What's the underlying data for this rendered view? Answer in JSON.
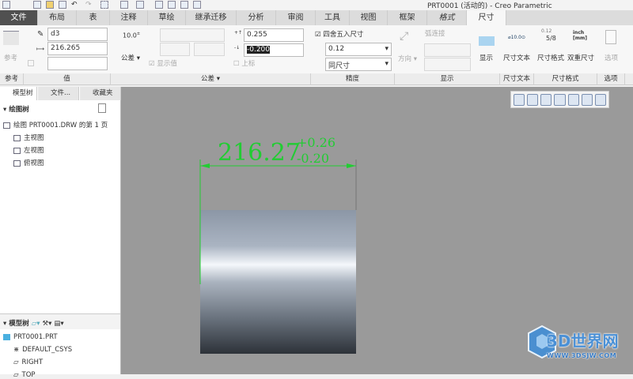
{
  "window": {
    "title": "PRT0001 (活动的) - Creo Parametric"
  },
  "tabs": [
    "文件",
    "布局",
    "表",
    "注释",
    "草绘",
    "继承迁移",
    "分析",
    "审阅",
    "工具",
    "视图",
    "框架",
    "格式",
    "尺寸"
  ],
  "ribbon": {
    "reference": {
      "label": "参考",
      "group": "参考"
    },
    "value": {
      "name": "d3",
      "value": "216.265",
      "group": "值"
    },
    "tolerance": {
      "button": "公差",
      "show_value": "显示值",
      "upper": "0.255",
      "lower": "-0.200",
      "superscript": "上标",
      "group": "公差"
    },
    "precision": {
      "round": "四舍五入尺寸",
      "decimal": "0.12",
      "tol_precision": "同尺寸",
      "group": "精度"
    },
    "display": {
      "direction": "方向",
      "arc_connect": "弧连接",
      "display": "显示",
      "group": "显示"
    },
    "dim_text": {
      "label": "尺寸文本",
      "group": "尺寸文本",
      "icon_text": "⌀10.0⊙"
    },
    "dim_format": {
      "format": "尺寸格式",
      "dual": "双重尺寸",
      "group": "尺寸格式",
      "fmt_top": "0.12",
      "fmt_bottom": "5/8",
      "dual_top": "inch",
      "dual_bottom": "[mm]"
    },
    "options": {
      "label": "选项",
      "group": "选项"
    }
  },
  "left_panel": {
    "tabs": [
      "模型树",
      "文件...",
      "收藏夹"
    ],
    "drawing_tree": {
      "title": "绘图树",
      "root": "绘图 PRT0001.DRW 的第 1 页",
      "views": [
        "主视图",
        "左视图",
        "俯视图"
      ]
    },
    "model_tree": {
      "title": "模型树",
      "root": "PRT0001.PRT",
      "items": [
        "DEFAULT_CSYS",
        "RIGHT",
        "TOP"
      ]
    }
  },
  "drawing": {
    "dimension": "216.27",
    "upper_tol": "+0.26",
    "lower_tol": "-0.20",
    "color": "#22cc33"
  },
  "watermark": {
    "text": "3D世界网",
    "url": "WWW.3DSJW.COM"
  }
}
